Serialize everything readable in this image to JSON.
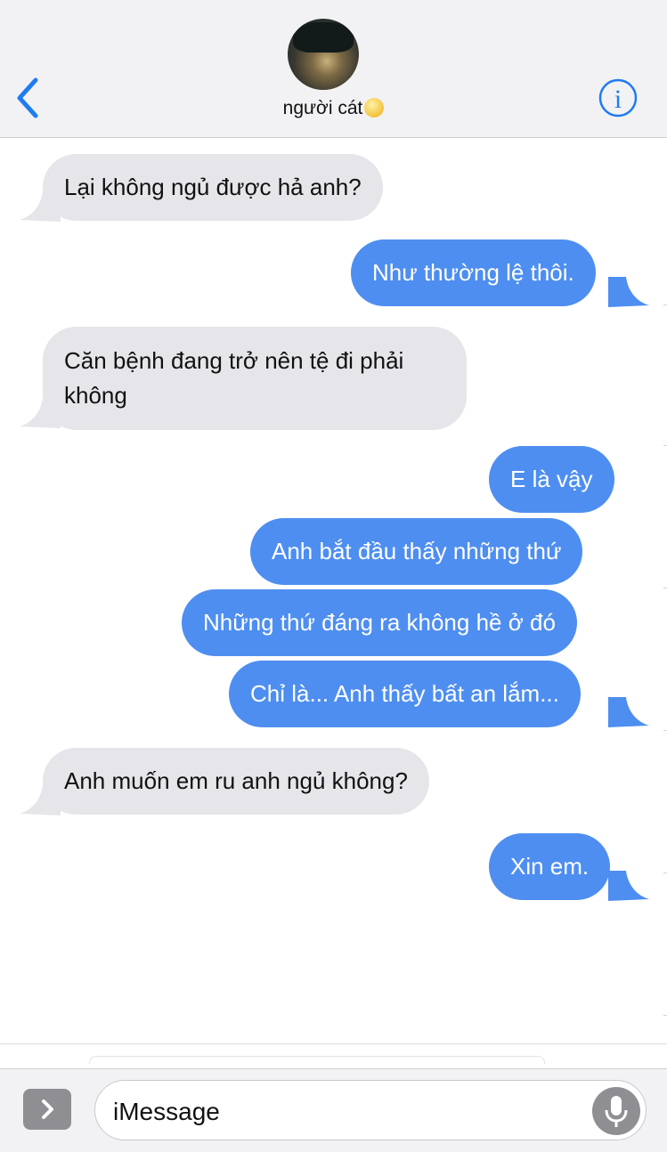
{
  "header": {
    "contact_name": "người cát",
    "avatar_icon": "profile-photo",
    "back_icon": "chevron-left-icon",
    "info_icon": "info-icon",
    "status_emoji": "moon-icon"
  },
  "messages": [
    {
      "direction": "received",
      "text": "Lại không ngủ được hả anh?"
    },
    {
      "direction": "sent",
      "text": "Như thường lệ thôi."
    },
    {
      "direction": "received",
      "lines": [
        "Căn bệnh đang trở nên tệ đi phải",
        "không"
      ]
    },
    {
      "direction": "sent",
      "text": "E là vậy"
    },
    {
      "direction": "sent",
      "text": "Anh bắt đầu thấy những thứ"
    },
    {
      "direction": "sent",
      "text": "Những thứ đáng ra không hề ở đó"
    },
    {
      "direction": "sent",
      "text": "Chỉ là... Anh thấy bất an lắm..."
    },
    {
      "direction": "received",
      "text": "Anh muốn em ru anh ngủ không?"
    },
    {
      "direction": "sent",
      "text": "Xin em."
    }
  ],
  "composer": {
    "placeholder": "iMessage",
    "apps_icon": "chevron-right-icon",
    "mic_icon": "microphone-icon"
  },
  "colors": {
    "sent_bubble": "#4e8ef0",
    "received_bubble": "#e5e5ea",
    "accent": "#1f7cf0"
  }
}
